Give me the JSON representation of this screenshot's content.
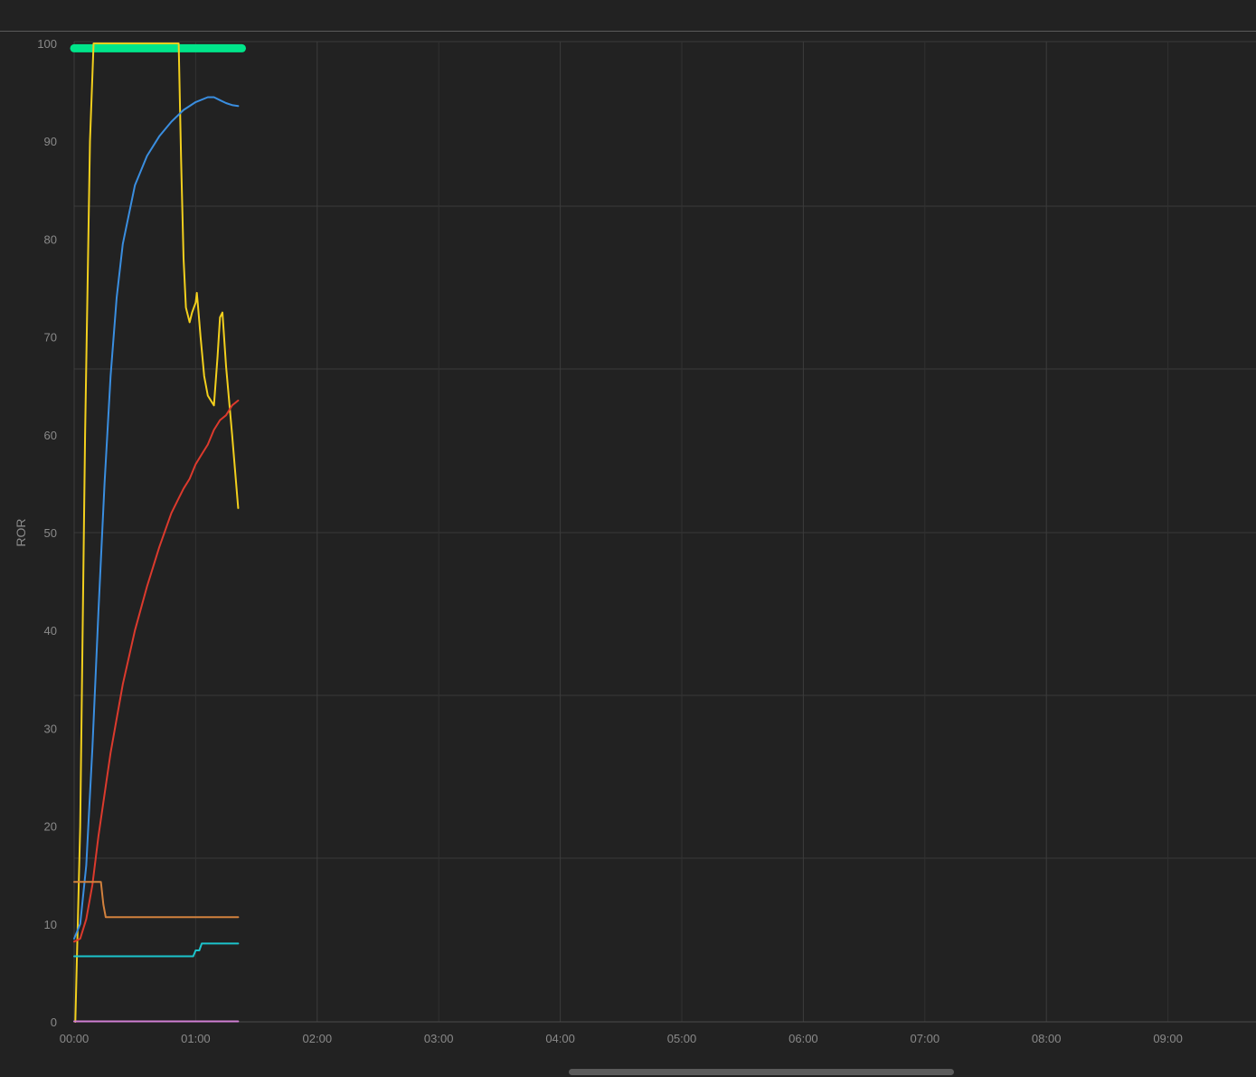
{
  "chart_data": {
    "type": "line",
    "ylabel": "ROR",
    "xlabel": "",
    "title": "",
    "x_unit": "minutes",
    "xlim": [
      0,
      10
    ],
    "ylim": [
      0,
      100
    ],
    "x_ticks": [
      "00:00",
      "01:00",
      "02:00",
      "03:00",
      "04:00",
      "05:00",
      "06:00",
      "07:00",
      "08:00",
      "09:00"
    ],
    "y_ticks": [
      "0",
      "10",
      "20",
      "30",
      "40",
      "50",
      "60",
      "70",
      "80",
      "90",
      "100"
    ],
    "grid": true,
    "series": [
      {
        "color": "#00e58a",
        "width": 9,
        "x": [
          0,
          1.38
        ],
        "y": [
          99.5,
          99.5
        ]
      },
      {
        "color": "#f2cf1d",
        "width": 2,
        "x": [
          0.01,
          0.05,
          0.09,
          0.13,
          0.16,
          0.86,
          0.88,
          0.9,
          0.92,
          0.95,
          0.97,
          1.0,
          1.01,
          1.02,
          1.04,
          1.07,
          1.1,
          1.15,
          1.18,
          1.2,
          1.22,
          1.25,
          1.3,
          1.35
        ],
        "y": [
          0,
          20,
          60,
          90,
          100,
          100,
          88,
          78,
          73,
          71.5,
          72.5,
          73.5,
          74.5,
          73,
          70,
          66,
          64,
          63,
          68,
          72,
          72.5,
          67,
          60,
          52.5
        ]
      },
      {
        "color": "#3a8ee0",
        "width": 2,
        "x": [
          0,
          0.05,
          0.1,
          0.15,
          0.2,
          0.25,
          0.3,
          0.35,
          0.4,
          0.5,
          0.6,
          0.7,
          0.8,
          0.9,
          1.0,
          1.1,
          1.15,
          1.2,
          1.25,
          1.3,
          1.35
        ],
        "y": [
          8.5,
          10,
          16,
          28,
          42,
          55,
          66,
          74,
          79.5,
          85.5,
          88.5,
          90.5,
          92,
          93.2,
          94,
          94.5,
          94.5,
          94.2,
          93.9,
          93.7,
          93.6
        ]
      },
      {
        "color": "#dc3a2d",
        "width": 2,
        "x": [
          0,
          0.05,
          0.1,
          0.15,
          0.2,
          0.3,
          0.4,
          0.5,
          0.6,
          0.7,
          0.8,
          0.86,
          0.9,
          0.95,
          1.0,
          1.05,
          1.1,
          1.15,
          1.2,
          1.25,
          1.3,
          1.35
        ],
        "y": [
          8.2,
          8.5,
          10.5,
          14,
          19,
          27.5,
          34.5,
          40,
          44.5,
          48.5,
          52,
          53.5,
          54.5,
          55.5,
          57,
          58,
          59,
          60.5,
          61.5,
          62,
          63,
          63.5
        ]
      },
      {
        "color": "#d2813d",
        "width": 2,
        "x": [
          0,
          0.22,
          0.24,
          0.26,
          1.35
        ],
        "y": [
          14.3,
          14.3,
          12,
          10.7,
          10.7
        ]
      },
      {
        "color": "#1cc4cc",
        "width": 2,
        "x": [
          0,
          0.98,
          1.0,
          1.03,
          1.05,
          1.07,
          1.35
        ],
        "y": [
          6.7,
          6.7,
          7.3,
          7.3,
          8.0,
          8.0,
          8.0
        ]
      },
      {
        "color": "#d17fd4",
        "width": 2,
        "x": [
          0,
          1.35
        ],
        "y": [
          0.05,
          0.05
        ]
      }
    ]
  }
}
